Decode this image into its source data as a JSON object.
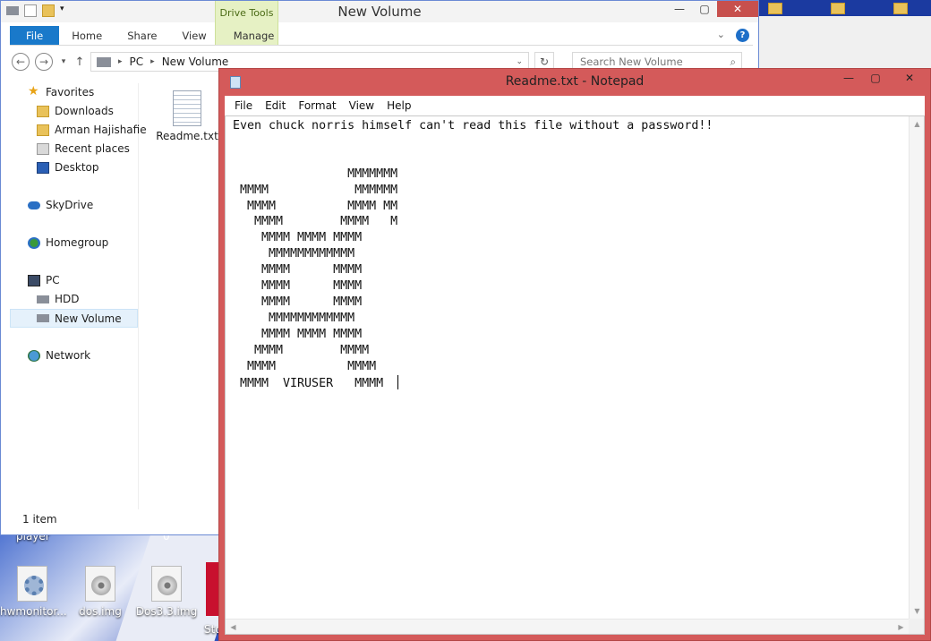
{
  "desktop": {
    "icons": [
      {
        "label": "hwmonitor..."
      },
      {
        "label": "dos.img"
      },
      {
        "label": "Dos3.3.img"
      }
    ],
    "partial_labels": [
      "player",
      "0",
      "Sto"
    ]
  },
  "explorer": {
    "title": "New Volume",
    "contextual_tab": "Drive Tools",
    "ribbon_tabs": [
      "File",
      "Home",
      "Share",
      "View",
      "Manage"
    ],
    "breadcrumb": [
      "PC",
      "New Volume"
    ],
    "search_placeholder": "Search New Volume",
    "nav": {
      "favorites": "Favorites",
      "favorite_items": [
        "Downloads",
        "Arman Hajishafie",
        "Recent places",
        "Desktop"
      ],
      "skydrive": "SkyDrive",
      "homegroup": "Homegroup",
      "pc": "PC",
      "pc_items": [
        "HDD",
        "New Volume"
      ],
      "network": "Network"
    },
    "file": {
      "name": "Readme.txt"
    },
    "status": "1 item"
  },
  "notepad": {
    "title": "Readme.txt - Notepad",
    "menu": [
      "File",
      "Edit",
      "Format",
      "View",
      "Help"
    ],
    "content": "Even chuck norris himself can't read this file without a password!!\n\n\n                MMMMMMM\n MMMM            MMMMMM\n  MMMM          MMMM MM\n   MMMM        MMMM   M\n    MMMM MMMM MMMM\n     MMMMMMMMMMMM\n    MMMM      MMMM\n    MMMM      MMMM\n    MMMM      MMMM\n     MMMMMMMMMMMM\n    MMMM MMMM MMMM\n   MMMM        MMMM\n  MMMM          MMMM\n MMMM  VIRUSER   MMMM  "
  },
  "colors": {
    "file_tab": "#1979ca",
    "notepad_frame": "#d45a5a",
    "drive_tools": "#e6f1c4",
    "close_button": "#c7504d"
  }
}
